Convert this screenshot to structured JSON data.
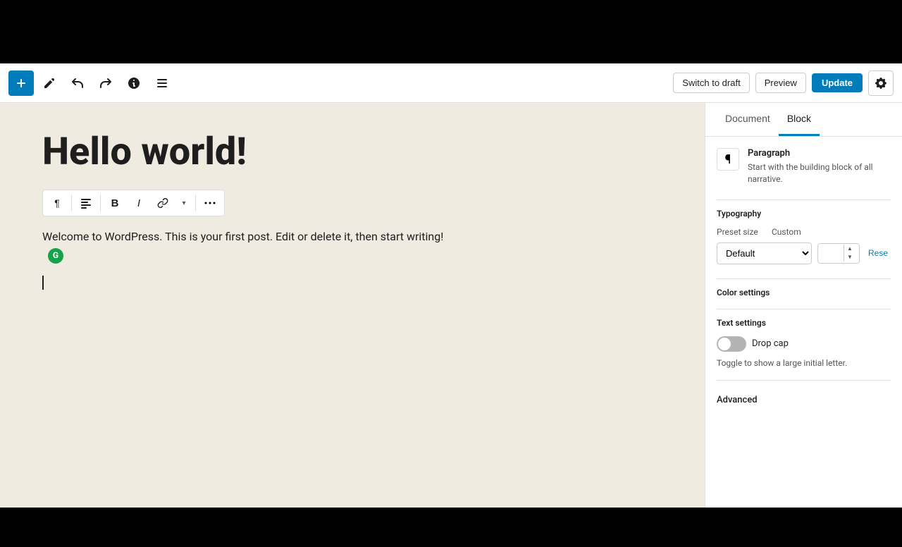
{
  "topBar": {
    "visible": true
  },
  "toolbar": {
    "add_label": "+",
    "undo_label": "↩",
    "redo_label": "↪",
    "info_label": "ℹ",
    "list_label": "≡",
    "switch_draft_label": "Switch to draft",
    "preview_label": "Preview",
    "update_label": "Update"
  },
  "editor": {
    "title": "Hello world!",
    "content": "Welcome to WordPress. This is your first post. Edit or delete it, then start writing!"
  },
  "blockToolbar": {
    "paragraph_icon": "¶",
    "align_icon": "≡",
    "bold_label": "B",
    "italic_label": "I",
    "link_label": "🔗",
    "dropdown_label": "▾",
    "more_label": "⋯"
  },
  "sidebar": {
    "tab_document": "Document",
    "tab_block": "Block",
    "block_name": "Paragraph",
    "block_desc": "Start with the building block of all narrative.",
    "typography_label": "Typography",
    "preset_size_label": "Preset size",
    "custom_label": "Custom",
    "preset_default": "Default",
    "reset_label": "Rese",
    "color_settings_label": "Color settings",
    "text_settings_label": "Text settings",
    "drop_cap_label": "Drop cap",
    "drop_cap_desc": "Toggle to show a large initial letter.",
    "advanced_label": "Advanced"
  }
}
